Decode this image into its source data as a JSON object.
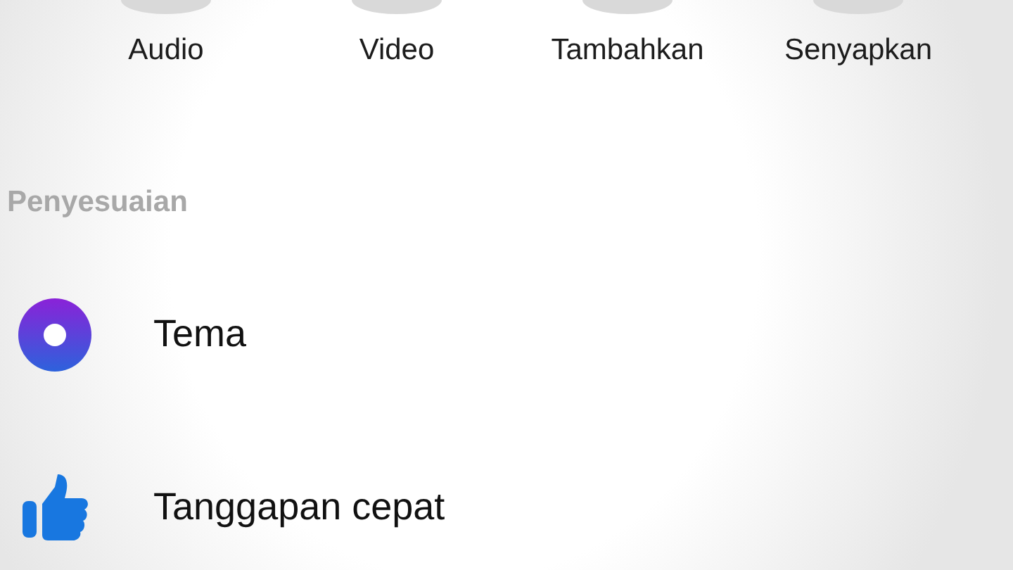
{
  "actions": [
    {
      "label": "Audio"
    },
    {
      "label": "Video"
    },
    {
      "label": "Tambahkan"
    },
    {
      "label": "Senyapkan"
    }
  ],
  "section": {
    "title": "Penyesuaian"
  },
  "items": [
    {
      "kind": "theme",
      "label": "Tema"
    },
    {
      "kind": "quick-reaction",
      "label": "Tanggapan cepat"
    }
  ]
}
